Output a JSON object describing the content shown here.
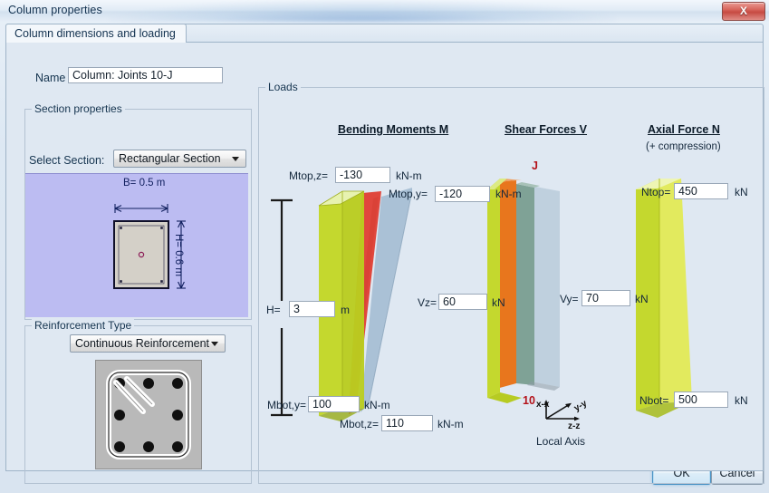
{
  "window": {
    "title": "Column properties",
    "close_icon": "close-icon",
    "close_glyph": "X"
  },
  "tabs": [
    {
      "label": "Column dimensions and loading",
      "active": true
    }
  ],
  "name_row": {
    "label": "Name",
    "value": "Column: Joints 10-J"
  },
  "section_properties": {
    "group_label": "Section properties",
    "select_label": "Select Section:",
    "selected_section": "Rectangular Section",
    "section_options": [
      "Rectangular Section"
    ],
    "diagram": {
      "width_label": "B= 0.5 m",
      "height_label": "H= 0.6 m",
      "fill_color": "#bcbcf2",
      "concrete_color": "#d4d0c8"
    }
  },
  "reinforcement": {
    "group_label": "Reinforcement Type",
    "selected_type": "Continuous Reinforcement",
    "type_options": [
      "Continuous Reinforcement"
    ]
  },
  "loads": {
    "group_label": "Loads",
    "columns": [
      {
        "title": "Bending Moments M",
        "subtitle": ""
      },
      {
        "title": "Shear Forces V",
        "subtitle": ""
      },
      {
        "title": "Axial Force N",
        "subtitle": "(+ compression)"
      }
    ],
    "height": {
      "label": "H=",
      "value": "3",
      "unit": "m"
    },
    "fields": [
      {
        "name": "mtop-z",
        "label": "Mtop,z=",
        "value": "-130",
        "unit": "kN-m"
      },
      {
        "name": "mtop-y",
        "label": "Mtop,y=",
        "value": "-120",
        "unit": "kN-m"
      },
      {
        "name": "vz",
        "label": "Vz=",
        "value": "60",
        "unit": "kN"
      },
      {
        "name": "vy",
        "label": "Vy=",
        "value": "70",
        "unit": "kN"
      },
      {
        "name": "ntop",
        "label": "Ntop=",
        "value": "450",
        "unit": "kN"
      },
      {
        "name": "mbot-y",
        "label": "Mbot,y=",
        "value": "100",
        "unit": "kN-m"
      },
      {
        "name": "mbot-z",
        "label": "Mbot,z=",
        "value": "110",
        "unit": "kN-m"
      },
      {
        "name": "nbot",
        "label": "Nbot=",
        "value": "500",
        "unit": "kN"
      }
    ],
    "joint_markers": {
      "top": "J",
      "bottom": "10",
      "color": "#b4121a"
    },
    "local_axis": {
      "caption": "Local Axis",
      "axis_x": "x-x",
      "axis_y": "y-y",
      "axis_z": "z-z"
    },
    "diagram_colors": {
      "column_green": "#c4d82e",
      "moment_red": "#e03a2f",
      "moment_blue": "#9fb8cf",
      "shear_orange": "#e8761d",
      "shear_teal": "#7fa296",
      "axial_yellow": "#d7e23a"
    }
  },
  "footer": {
    "ok_label": "OK",
    "cancel_label": "Cancel"
  }
}
